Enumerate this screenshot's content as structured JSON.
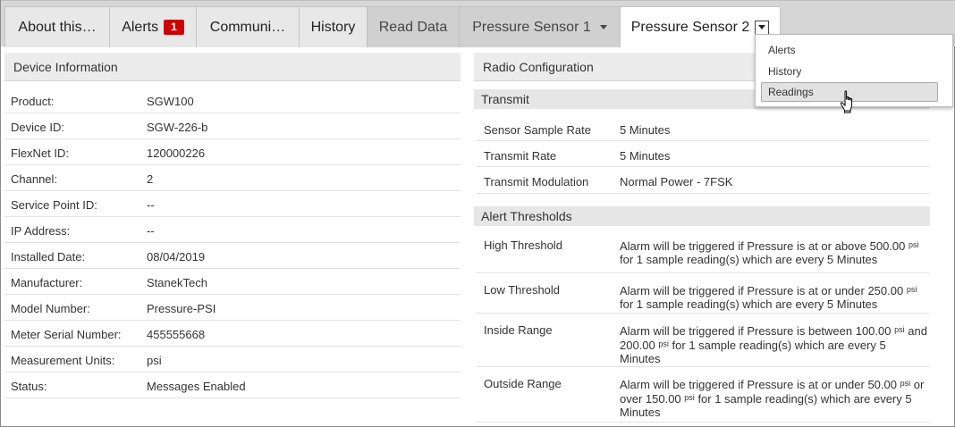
{
  "tabs": [
    {
      "label": "About this…"
    },
    {
      "label": "Alerts",
      "badge": "1"
    },
    {
      "label": "Communi…"
    },
    {
      "label": "History"
    },
    {
      "label": "Read Data"
    },
    {
      "label": "Pressure Sensor 1"
    },
    {
      "label": "Pressure Sensor 2"
    }
  ],
  "device_info": {
    "title": "Device Information",
    "rows": [
      {
        "label": "Product:",
        "value": "SGW100"
      },
      {
        "label": "Device ID:",
        "value": "SGW-226-b"
      },
      {
        "label": "FlexNet ID:",
        "value": "120000226"
      },
      {
        "label": "Channel:",
        "value": "2"
      },
      {
        "label": "Service Point ID:",
        "value": "--"
      },
      {
        "label": "IP Address:",
        "value": "--"
      },
      {
        "label": "Installed Date:",
        "value": "08/04/2019"
      },
      {
        "label": "Manufacturer:",
        "value": "StanekTech"
      },
      {
        "label": "Model Number:",
        "value": "Pressure-PSI"
      },
      {
        "label": "Meter Serial Number:",
        "value": "455555668"
      },
      {
        "label": "Measurement Units:",
        "value": "psi"
      },
      {
        "label": "Status:",
        "value": "Messages Enabled"
      }
    ]
  },
  "radio_config": {
    "title": "Radio Configuration",
    "transmit": {
      "title": "Transmit",
      "rows": [
        {
          "label": "Sensor Sample Rate",
          "value": "5 Minutes"
        },
        {
          "label": "Transmit Rate",
          "value": "5 Minutes"
        },
        {
          "label": "Transmit Modulation",
          "value": "Normal Power - 7FSK"
        }
      ]
    },
    "alert_thresholds": {
      "title": "Alert Thresholds",
      "unit": "psi",
      "high": {
        "label": "High Threshold",
        "t1": "Alarm will be triggered if Pressure is at or above 500.00",
        "t2": "for 1 sample reading(s) which are every 5 Minutes"
      },
      "low": {
        "label": "Low Threshold",
        "t1": "Alarm will be triggered if Pressure is at or under 250.00",
        "t2": "for 1 sample reading(s) which are every 5 Minutes"
      },
      "inside": {
        "label": "Inside Range",
        "t1": "Alarm will be triggered if Pressure is between 100.00",
        "t2": "and",
        "t3": "200.00",
        "t4": "for 1 sample reading(s) which are every 5",
        "t5": "Minutes"
      },
      "outside": {
        "label": "Outside Range",
        "t1": "Alarm will be triggered if Pressure is at or under 50.00",
        "t2": "or",
        "t3": "over 150.00",
        "t4": "for 1 sample reading(s) which are every 5",
        "t5": "Minutes"
      }
    }
  },
  "dropdown": {
    "items": [
      {
        "label": "Alerts"
      },
      {
        "label": "History"
      },
      {
        "label": "Readings"
      }
    ]
  }
}
